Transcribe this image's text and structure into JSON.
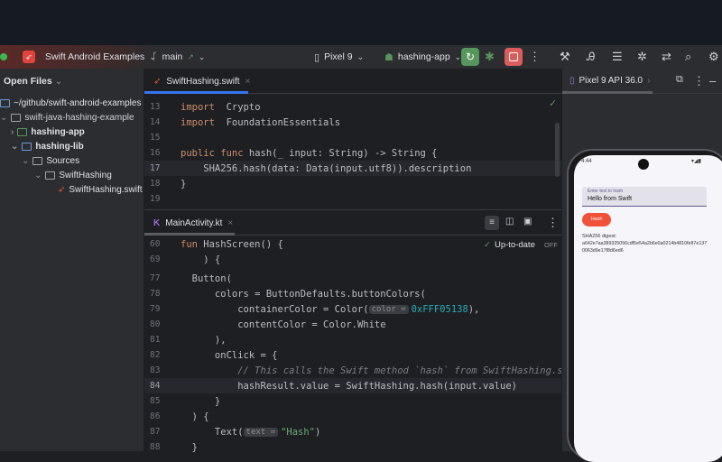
{
  "toolbar": {
    "project": "Swift Android Examples",
    "branch": "main",
    "device": "Pixel 9",
    "run_config": "hashing-app"
  },
  "sidebar": {
    "title": "Open Files",
    "items": [
      {
        "label": "~/github/swift-android-examples"
      },
      {
        "label": "swift-java-hashing-example"
      },
      {
        "label": "hashing-app"
      },
      {
        "label": "hashing-lib"
      },
      {
        "label": "Sources"
      },
      {
        "label": "SwiftHashing"
      },
      {
        "label": "SwiftHashing.swift"
      }
    ]
  },
  "editor1": {
    "tab": "SwiftHashing.swift",
    "lines": [
      {
        "n": "13",
        "t": [
          [
            "kw",
            "import"
          ],
          [
            "",
            "  Crypto"
          ]
        ]
      },
      {
        "n": "14",
        "t": [
          [
            "kw",
            "import"
          ],
          [
            "",
            "  FoundationEssentials"
          ]
        ]
      },
      {
        "n": "15",
        "t": []
      },
      {
        "n": "16",
        "t": [
          [
            "kw",
            "public func"
          ],
          [
            "",
            " hash(_ input: String) -> String {"
          ]
        ]
      },
      {
        "n": "17",
        "t": [
          [
            "",
            "    SHA256.hash(data: Data(input.utf8)).description"
          ]
        ]
      },
      {
        "n": "18",
        "t": [
          [
            "",
            "}"
          ]
        ]
      },
      {
        "n": "19",
        "t": []
      }
    ]
  },
  "editor2": {
    "tab": "MainActivity.kt",
    "status": "Up-to-date",
    "off": "OFF",
    "lines": [
      {
        "n": "60",
        "t": [
          [
            "kw",
            "fun"
          ],
          [
            "",
            " HashScreen() {"
          ]
        ]
      },
      {
        "n": "69",
        "t": [
          [
            "",
            "    ) {"
          ]
        ]
      },
      {
        "n": "77",
        "t": [
          [
            "",
            "  Button("
          ]
        ]
      },
      {
        "n": "78",
        "t": [
          [
            "",
            "      colors = ButtonDefaults.buttonColors("
          ]
        ]
      },
      {
        "n": "79",
        "t": [
          [
            "",
            "          containerColor = Color("
          ],
          [
            "hint",
            "color ="
          ],
          [
            "num",
            "0xFFF05138"
          ],
          [
            "",
            "),"
          ]
        ]
      },
      {
        "n": "80",
        "t": [
          [
            "",
            "          contentColor = Color.White"
          ]
        ]
      },
      {
        "n": "81",
        "t": [
          [
            "",
            "      ),"
          ]
        ]
      },
      {
        "n": "82",
        "t": [
          [
            "",
            "      onClick = {"
          ]
        ]
      },
      {
        "n": "83",
        "t": [
          [
            "cm",
            "          // This calls the Swift method `hash` from SwiftHashing.swift"
          ]
        ]
      },
      {
        "n": "84",
        "t": [
          [
            "",
            "          hashResult.value = SwiftHashing.hash(input.value)"
          ]
        ]
      },
      {
        "n": "85",
        "t": [
          [
            "",
            "      }"
          ]
        ]
      },
      {
        "n": "86",
        "t": [
          [
            "",
            "  ) {"
          ]
        ]
      },
      {
        "n": "87",
        "t": [
          [
            "",
            "      Text("
          ],
          [
            "hint",
            "text ="
          ],
          [
            "str",
            "\"Hash\""
          ],
          [
            "",
            ")"
          ]
        ]
      },
      {
        "n": "88",
        "t": [
          [
            "",
            "  }"
          ]
        ]
      }
    ]
  },
  "emulator": {
    "tab": "Pixel 9 API 36.0",
    "time": "4:44",
    "field_label": "Enter text to hash",
    "field_value": "Hello from Swift",
    "button": "Hash",
    "digest_label": "SHA256 digest:",
    "digest": "a642e7aa389325056cdf5e54a2b6e0a0214b4810fe87e1370063d9e17f8d6ed6"
  },
  "colors": {
    "accent": "#3574f0",
    "run": "#57965c",
    "stop": "#db5c5c",
    "swift": "#f05138"
  }
}
